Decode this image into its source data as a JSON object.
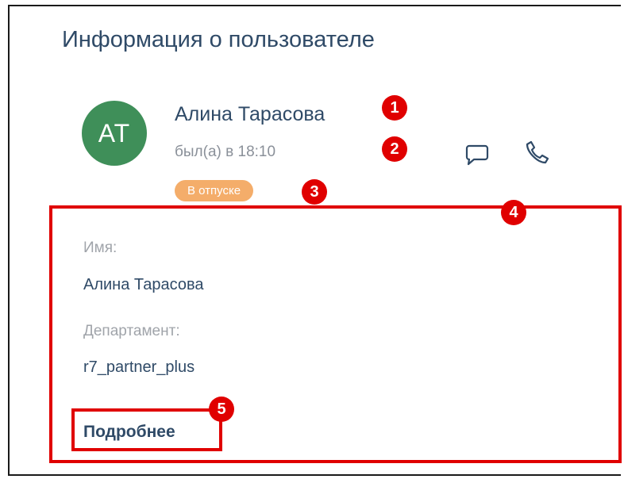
{
  "panel": {
    "title": "Информация о пользователе"
  },
  "user": {
    "initials": "АТ",
    "name": "Алина Тарасова",
    "last_seen": "был(а) в 18:10",
    "status": "В отпуске",
    "avatar_color": "#3f8f59",
    "status_color": "#f4ad6a"
  },
  "actions": {
    "message_icon": "chat-bubble-icon",
    "call_icon": "phone-icon"
  },
  "details": {
    "name_label": "Имя:",
    "name_value": "Алина Тарасова",
    "department_label": "Департамент:",
    "department_value": "r7_partner_plus",
    "more_link": "Подробнее"
  },
  "markers": [
    "1",
    "2",
    "3",
    "4",
    "5"
  ],
  "colors": {
    "accent": "#2f4a67",
    "marker": "#e00000"
  }
}
